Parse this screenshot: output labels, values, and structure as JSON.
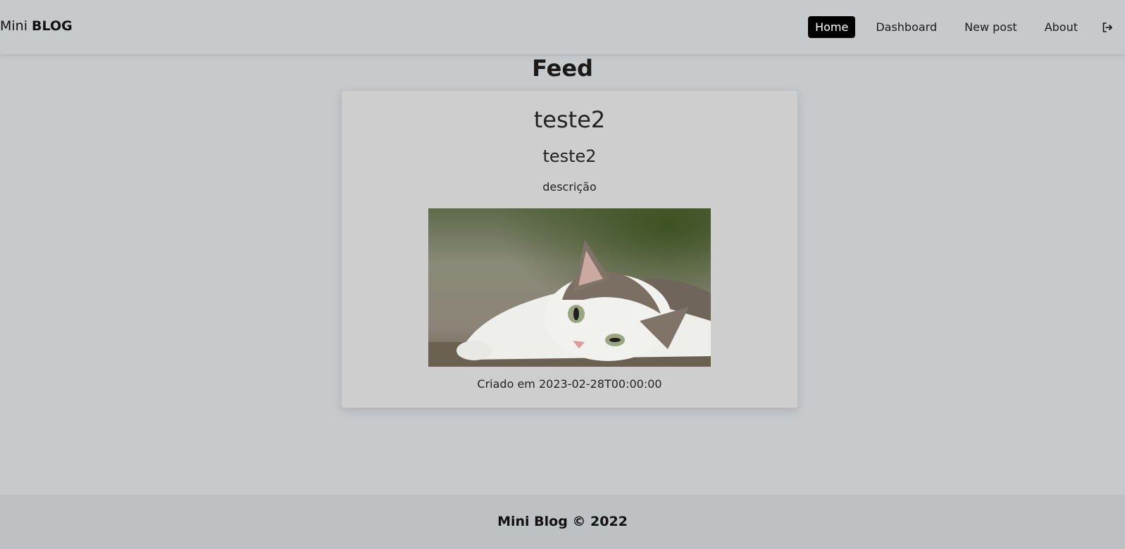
{
  "navbar": {
    "brand_light": "Mini",
    "brand_bold": "BLOG",
    "items": [
      {
        "label": "Home",
        "active": true
      },
      {
        "label": "Dashboard",
        "active": false
      },
      {
        "label": "New post",
        "active": false
      },
      {
        "label": "About",
        "active": false
      }
    ],
    "logout_icon": "logout-icon"
  },
  "page": {
    "title": "Feed"
  },
  "post": {
    "title": "teste2",
    "subtitle": "teste2",
    "description": "descrição",
    "image_alt": "cat lying on ground",
    "date": "Criado em 2023-02-28T00:00:00"
  },
  "footer": {
    "text": "Mini Blog © 2022"
  },
  "colors": {
    "background": "#c6cacd",
    "card": "#cecece",
    "active_nav": "#000000",
    "footer": "#bec1c4"
  }
}
